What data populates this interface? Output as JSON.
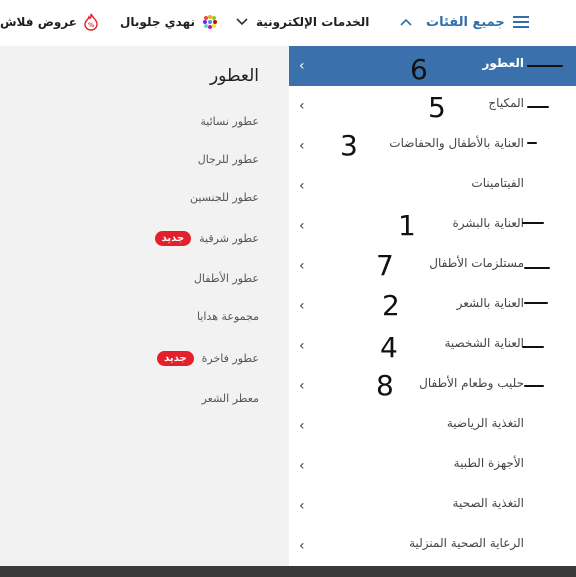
{
  "topbar": {
    "all_categories": "جميع الفئات",
    "e_services": "الخدمات الإلكترونية",
    "nahdi_global": "نهدي جلوبال",
    "flash_offers": "عروض فلاش"
  },
  "subcategories": {
    "title": "العطور",
    "items": [
      {
        "label": "عطور نسائية",
        "badge": ""
      },
      {
        "label": "عطور للرجال",
        "badge": ""
      },
      {
        "label": "عطور للجنسين",
        "badge": ""
      },
      {
        "label": "عطور شرقية",
        "badge": "جديد"
      },
      {
        "label": "عطور الأطفال",
        "badge": ""
      },
      {
        "label": "مجموعة هدايا",
        "badge": ""
      },
      {
        "label": "عطور فاخرة",
        "badge": "جديد"
      },
      {
        "label": "معطر الشعر",
        "badge": ""
      }
    ]
  },
  "categories": [
    {
      "label": "العطور",
      "active": true
    },
    {
      "label": "المكياج",
      "active": false
    },
    {
      "label": "العناية بالأطفال والحفاضات",
      "active": false
    },
    {
      "label": "الفيتامينات",
      "active": false
    },
    {
      "label": "العناية بالبشرة",
      "active": false
    },
    {
      "label": "مستلزمات الأطفال",
      "active": false
    },
    {
      "label": "العناية بالشعر",
      "active": false
    },
    {
      "label": "العناية الشخصية",
      "active": false
    },
    {
      "label": "حليب وطعام الأطفال",
      "active": false
    },
    {
      "label": "التغذية الرياضية",
      "active": false
    },
    {
      "label": "الأجهزة الطبية",
      "active": false
    },
    {
      "label": "التغذية الصحية",
      "active": false
    },
    {
      "label": "الرعاية الصحية المنزلية",
      "active": false
    }
  ],
  "annotations": [
    "6",
    "5",
    "3",
    "1",
    "7",
    "2",
    "4",
    "8"
  ],
  "colors": {
    "accent": "#3a71ad",
    "badge": "#e3202b",
    "panel_bg": "#f2f2f2"
  }
}
